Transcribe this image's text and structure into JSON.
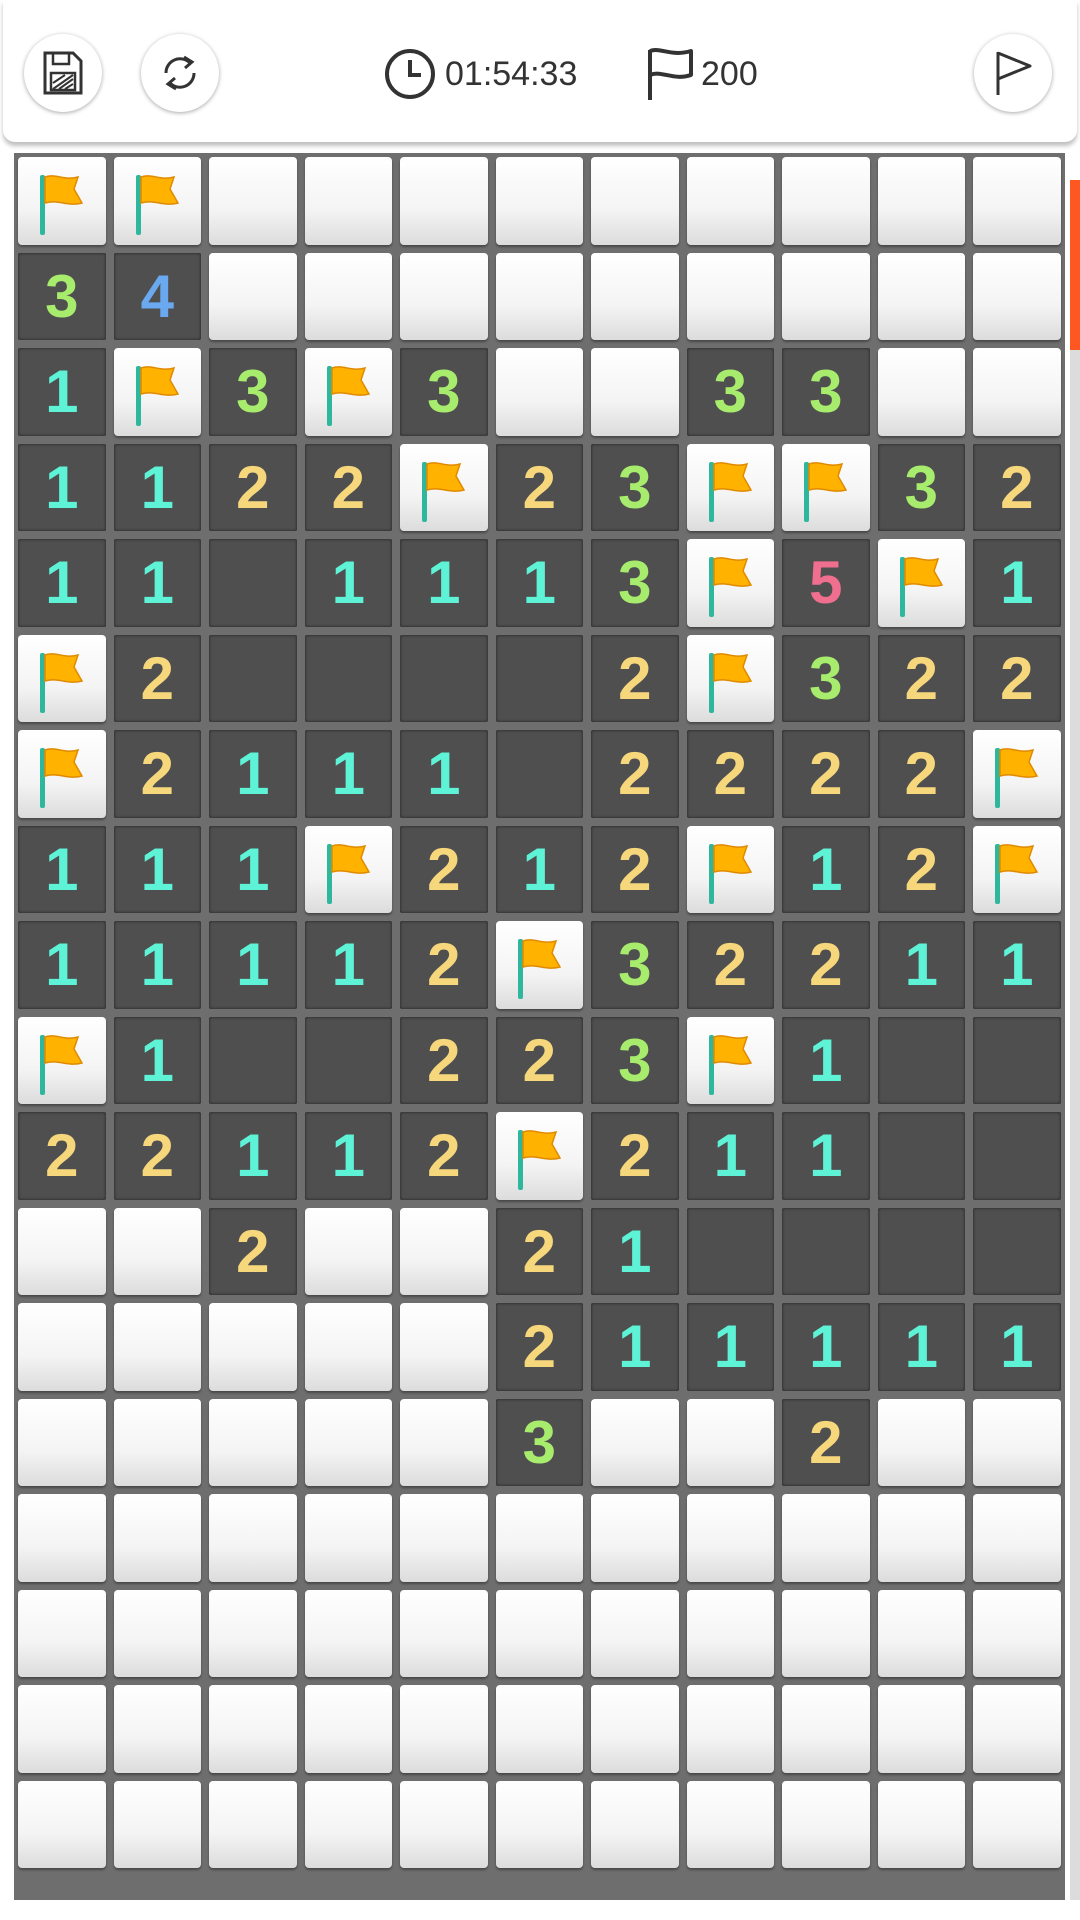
{
  "header": {
    "timer": "01:54:33",
    "flags_remaining": "200",
    "buttons": [
      {
        "name": "save",
        "icon": "save-icon"
      },
      {
        "name": "restart",
        "icon": "refresh-icon"
      },
      {
        "name": "flag-mode",
        "icon": "flag-outline-icon"
      }
    ]
  },
  "board": {
    "columns": 11,
    "legend": "F = flagged, # = unopened, . = opened empty, digits = adjacent mine count",
    "rows": [
      [
        "F",
        "F",
        "#",
        "#",
        "#",
        "#",
        "#",
        "#",
        "#",
        "#",
        "#"
      ],
      [
        "3",
        "4",
        "#",
        "#",
        "#",
        "#",
        "#",
        "#",
        "#",
        "#",
        "#"
      ],
      [
        "1",
        "F",
        "3",
        "F",
        "3",
        "#",
        "#",
        "3",
        "3",
        "#",
        "#"
      ],
      [
        "1",
        "1",
        "2",
        "2",
        "F",
        "2",
        "3",
        "F",
        "F",
        "3",
        "2"
      ],
      [
        "1",
        "1",
        ".",
        "1",
        "1",
        "1",
        "3",
        "F",
        "5",
        "F",
        "1"
      ],
      [
        "F",
        "2",
        ".",
        ".",
        ".",
        ".",
        "2",
        "F",
        "3",
        "2",
        "2"
      ],
      [
        "F",
        "2",
        "1",
        "1",
        "1",
        ".",
        "2",
        "2",
        "2",
        "2",
        "F"
      ],
      [
        "1",
        "1",
        "1",
        "F",
        "2",
        "1",
        "2",
        "F",
        "1",
        "2",
        "F"
      ],
      [
        "1",
        "1",
        "1",
        "1",
        "2",
        "F",
        "3",
        "2",
        "2",
        "1",
        "1"
      ],
      [
        "F",
        "1",
        ".",
        ".",
        "2",
        "2",
        "3",
        "F",
        "1",
        ".",
        "."
      ],
      [
        "2",
        "2",
        "1",
        "1",
        "2",
        "F",
        "2",
        "1",
        "1",
        ".",
        "."
      ],
      [
        "#",
        "#",
        "2",
        "#",
        "#",
        "2",
        "1",
        ".",
        ".",
        ".",
        "."
      ],
      [
        "#",
        "#",
        "#",
        "#",
        "#",
        "2",
        "1",
        "1",
        "1",
        "1",
        "1"
      ],
      [
        "#",
        "#",
        "#",
        "#",
        "#",
        "3",
        "#",
        "#",
        "2",
        "#",
        "#"
      ],
      [
        "#",
        "#",
        "#",
        "#",
        "#",
        "#",
        "#",
        "#",
        "#",
        "#",
        "#"
      ],
      [
        "#",
        "#",
        "#",
        "#",
        "#",
        "#",
        "#",
        "#",
        "#",
        "#",
        "#"
      ],
      [
        "#",
        "#",
        "#",
        "#",
        "#",
        "#",
        "#",
        "#",
        "#",
        "#",
        "#"
      ],
      [
        "#",
        "#",
        "#",
        "#",
        "#",
        "#",
        "#",
        "#",
        "#",
        "#",
        "#"
      ]
    ],
    "number_colors": {
      "1": "#5ef2d6",
      "2": "#f7d77c",
      "3": "#a8ec6d",
      "4": "#6aa9ef",
      "5": "#f06e8e"
    },
    "flag_color": "#ffb300",
    "pole_color": "#2fb79e"
  },
  "accent_color": "#ff5722"
}
